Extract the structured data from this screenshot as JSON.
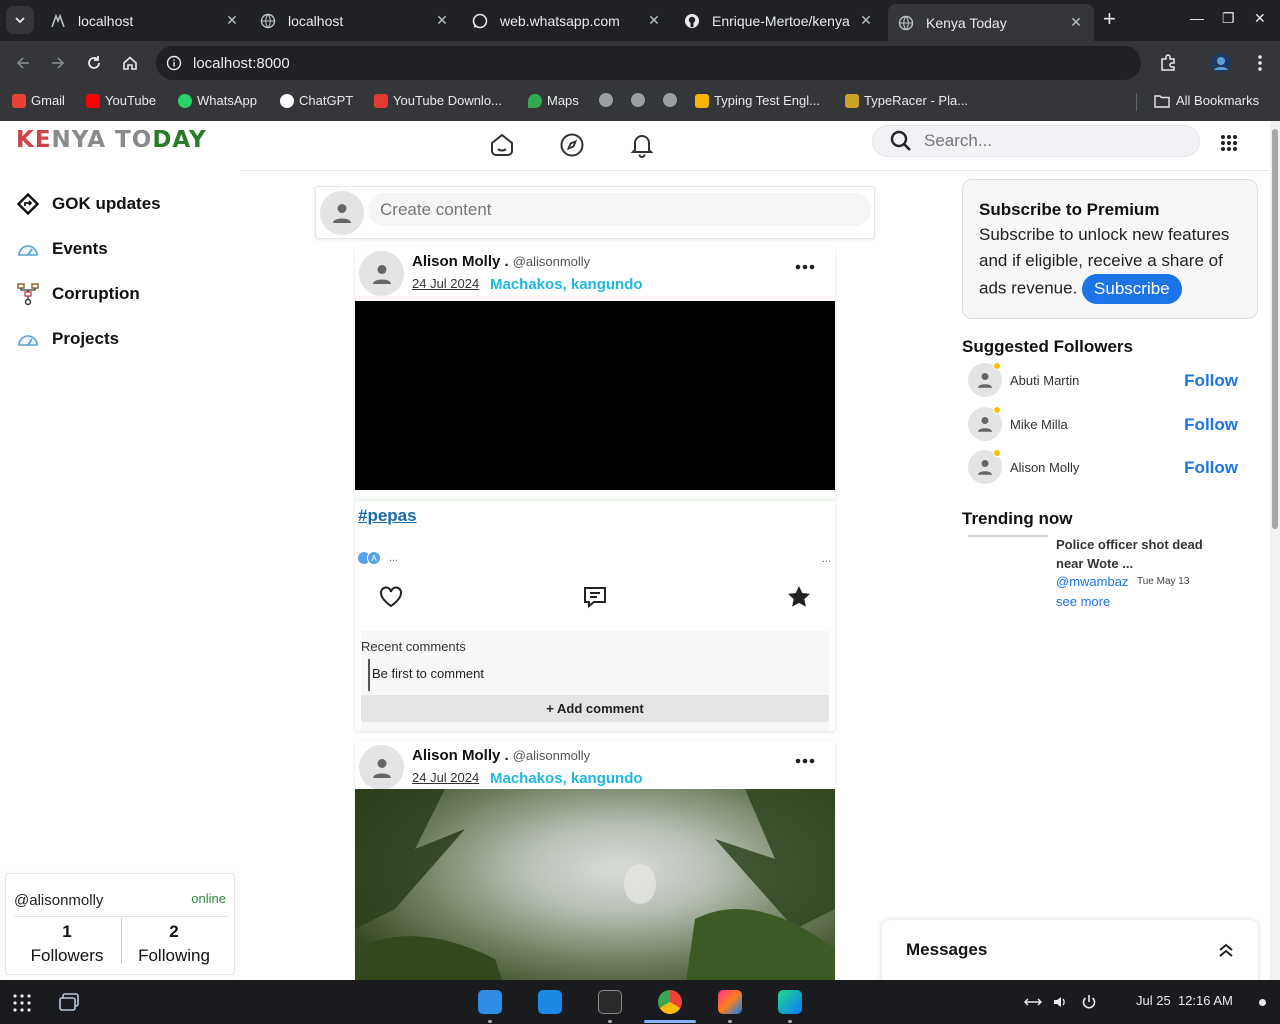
{
  "browser": {
    "tabs": [
      {
        "title": "localhost",
        "icon": "localhost-app-icon"
      },
      {
        "title": "localhost",
        "icon": "globe-icon"
      },
      {
        "title": "web.whatsapp.com",
        "icon": "whatsapp-icon"
      },
      {
        "title": "Enrique-Mertoe/kenya",
        "icon": "github-icon"
      },
      {
        "title": "Kenya Today",
        "icon": "globe-icon",
        "active": true
      }
    ],
    "url": "localhost:8000",
    "bookmarks": [
      {
        "label": "Gmail",
        "color": "#ea4335"
      },
      {
        "label": "YouTube",
        "color": "#ff0000"
      },
      {
        "label": "WhatsApp",
        "color": "#25d366"
      },
      {
        "label": "ChatGPT",
        "color": "#ffffff"
      },
      {
        "label": "YouTube Downlo...",
        "color": "#e53935"
      },
      {
        "label": "Maps",
        "color": "#34a853"
      },
      {
        "label": "",
        "color": "#9aa0a6"
      },
      {
        "label": "",
        "color": "#9aa0a6"
      },
      {
        "label": "",
        "color": "#9aa0a6"
      },
      {
        "label": "Typing Test Engl...",
        "color": "#f4b400"
      },
      {
        "label": "TypeRacer - Pla...",
        "color": "#c9a227"
      }
    ],
    "all_bookmarks": "All Bookmarks"
  },
  "header": {
    "logo": {
      "part1": "KE",
      "part2": "NYA TO",
      "part3": "DAY"
    },
    "search_placeholder": "Search..."
  },
  "sidebar": {
    "items": [
      {
        "label": "GOK updates",
        "icon": "diamond-arrow-icon"
      },
      {
        "label": "Events",
        "icon": "gauge-icon"
      },
      {
        "label": "Corruption",
        "icon": "network-icon"
      },
      {
        "label": "Projects",
        "icon": "gauge-icon"
      }
    ]
  },
  "profile_card": {
    "handle": "@alisonmolly",
    "status": "online",
    "followers_count": "1",
    "followers_label": "Followers",
    "following_count": "2",
    "following_label": "Following"
  },
  "create": {
    "placeholder": "Create content"
  },
  "posts": [
    {
      "author": "Alison Molly .",
      "handle": "@alisonmolly",
      "date": "24 Jul 2024",
      "location": "Machakos, kangundo",
      "hashtag": "#pepas",
      "react_letter": "A",
      "ellipsis": "...",
      "recent_comments_label": "Recent comments",
      "empty_comment": "Be first to comment",
      "add_comment": "+ Add comment"
    },
    {
      "author": "Alison Molly .",
      "handle": "@alisonmolly",
      "date": "24 Jul 2024",
      "location": "Machakos, kangundo"
    }
  ],
  "premium": {
    "title": "Subscribe to Premium",
    "text": "Subscribe to unlock new features and if eligible, receive a share of ads revenue.",
    "button": "Subscribe"
  },
  "suggested": {
    "title": "Suggested Followers",
    "follow_label": "Follow",
    "people": [
      "Abuti Martin",
      "Mike Milla",
      "Alison Molly"
    ]
  },
  "trending": {
    "title": "Trending now",
    "item": {
      "headline": "Police officer shot dead near Wote ...",
      "user": "@mwambaz",
      "date": "Tue May 13",
      "see_more": "see more"
    }
  },
  "messages": {
    "title": "Messages"
  },
  "taskbar": {
    "date": "Jul 25",
    "time": "12:16 AM"
  },
  "colors": {
    "accent": "#1d73e8",
    "location": "#1eb8e0",
    "online": "#2e8b3a",
    "hashtag": "#1a6aa8"
  }
}
